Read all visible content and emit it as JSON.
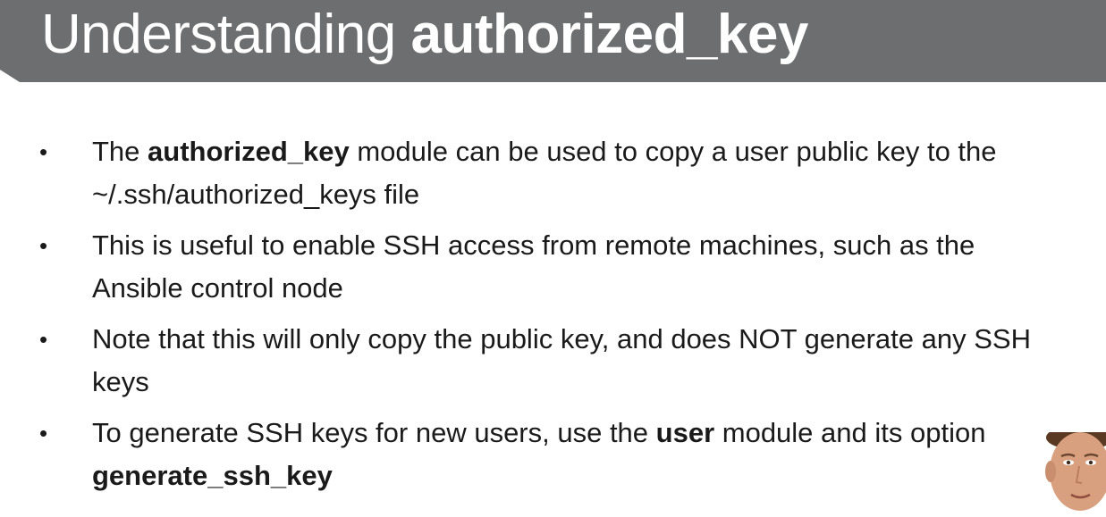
{
  "slide": {
    "title_regular": "Understanding ",
    "title_bold": "authorized_key",
    "bullets": [
      {
        "parts": [
          {
            "text": "The ",
            "bold": false
          },
          {
            "text": "authorized_key",
            "bold": true
          },
          {
            "text": " module can be used to copy a user public key to the ~/.ssh/authorized_keys file",
            "bold": false
          }
        ]
      },
      {
        "parts": [
          {
            "text": "This is useful to enable SSH access from remote machines, such as the Ansible control node",
            "bold": false
          }
        ]
      },
      {
        "parts": [
          {
            "text": "Note that this will only copy the public key, and does NOT generate any SSH keys",
            "bold": false
          }
        ]
      },
      {
        "parts": [
          {
            "text": "To generate SSH keys for new users, use the ",
            "bold": false
          },
          {
            "text": "user",
            "bold": true
          },
          {
            "text": " module and its option ",
            "bold": false
          },
          {
            "text": "generate_ssh_key",
            "bold": true
          }
        ]
      }
    ],
    "colors": {
      "title_bar": "#6d6e70",
      "title_text": "#ffffff",
      "body_text": "#1a1a1a"
    }
  }
}
